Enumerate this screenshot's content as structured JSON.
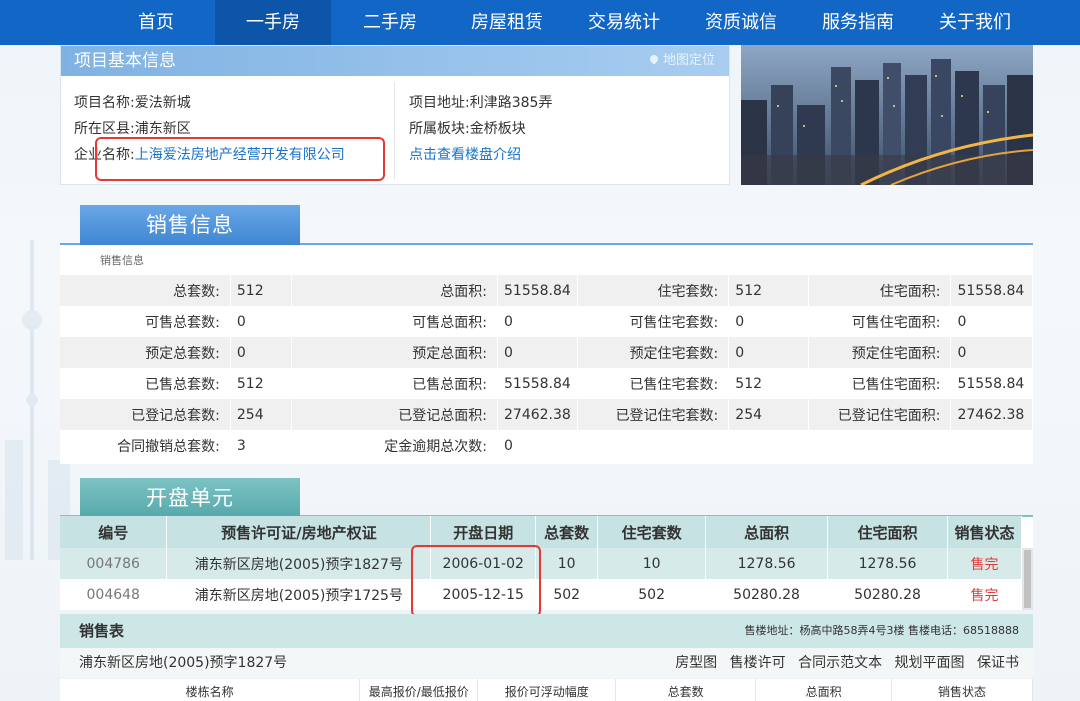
{
  "nav": {
    "items": [
      "首页",
      "一手房",
      "二手房",
      "房屋租赁",
      "交易统计",
      "资质诚信",
      "服务指南",
      "关于我们"
    ],
    "active_index": 1
  },
  "project_info": {
    "title": "项目基本信息",
    "map_link": "地图定位",
    "name_label": "项目名称:",
    "name_value": "爱法新城",
    "district_label": "所在区县:",
    "district_value": "浦东新区",
    "company_label": "企业名称:",
    "company_value": "上海爱法房地产经营开发有限公司",
    "address_label": "项目地址:",
    "address_value": "利津路385弄",
    "block_label": "所属板块:",
    "block_value": "金桥板块",
    "intro_link": "点击查看楼盘介绍"
  },
  "sales_info": {
    "tab_title": "销售信息",
    "caption": "销售信息",
    "rows": [
      [
        [
          "总套数:",
          "512"
        ],
        [
          "总面积:",
          "51558.84"
        ],
        [
          "住宅套数:",
          "512"
        ],
        [
          "住宅面积:",
          "51558.84"
        ]
      ],
      [
        [
          "可售总套数:",
          "0"
        ],
        [
          "可售总面积:",
          "0"
        ],
        [
          "可售住宅套数:",
          "0"
        ],
        [
          "可售住宅面积:",
          "0"
        ]
      ],
      [
        [
          "预定总套数:",
          "0"
        ],
        [
          "预定总面积:",
          "0"
        ],
        [
          "预定住宅套数:",
          "0"
        ],
        [
          "预定住宅面积:",
          "0"
        ]
      ],
      [
        [
          "已售总套数:",
          "512"
        ],
        [
          "已售总面积:",
          "51558.84"
        ],
        [
          "已售住宅套数:",
          "512"
        ],
        [
          "已售住宅面积:",
          "51558.84"
        ]
      ],
      [
        [
          "已登记总套数:",
          "254"
        ],
        [
          "已登记总面积:",
          "27462.38"
        ],
        [
          "已登记住宅套数:",
          "254"
        ],
        [
          "已登记住宅面积:",
          "27462.38"
        ]
      ],
      [
        [
          "合同撤销总套数:",
          "3"
        ],
        [
          "定金逾期总次数:",
          "0"
        ],
        [
          "",
          ""
        ],
        [
          "",
          ""
        ]
      ]
    ]
  },
  "open_units": {
    "tab_title": "开盘单元",
    "headers": [
      "编号",
      "预售许可证/房地产权证",
      "开盘日期",
      "总套数",
      "住宅套数",
      "总面积",
      "住宅面积",
      "销售状态"
    ],
    "rows": [
      [
        "004786",
        "浦东新区房地(2005)预字1827号",
        "2006-01-02",
        "10",
        "10",
        "1278.56",
        "1278.56",
        "售完"
      ],
      [
        "004648",
        "浦东新区房地(2005)预字1725号",
        "2005-12-15",
        "502",
        "502",
        "50280.28",
        "50280.28",
        "售完"
      ]
    ]
  },
  "sales_sheet": {
    "title": "销售表",
    "address": "售楼地址：杨高中路58弄4号3楼  售楼电话：68518888",
    "permit": "浦东新区房地(2005)预字1827号",
    "links": [
      "房型图",
      "售楼许可",
      "合同示范文本",
      "规划平面图",
      "保证书"
    ],
    "columns": [
      "楼栋名称",
      "最高报价/最低报价",
      "报价可浮动幅度",
      "总套数",
      "总面积",
      "销售状态"
    ]
  },
  "colors": {
    "nav": "#1166c6",
    "nav_active": "#0d55a8",
    "link": "#1a73c9",
    "highlight_box": "#e53935",
    "sold": "#e53935"
  }
}
